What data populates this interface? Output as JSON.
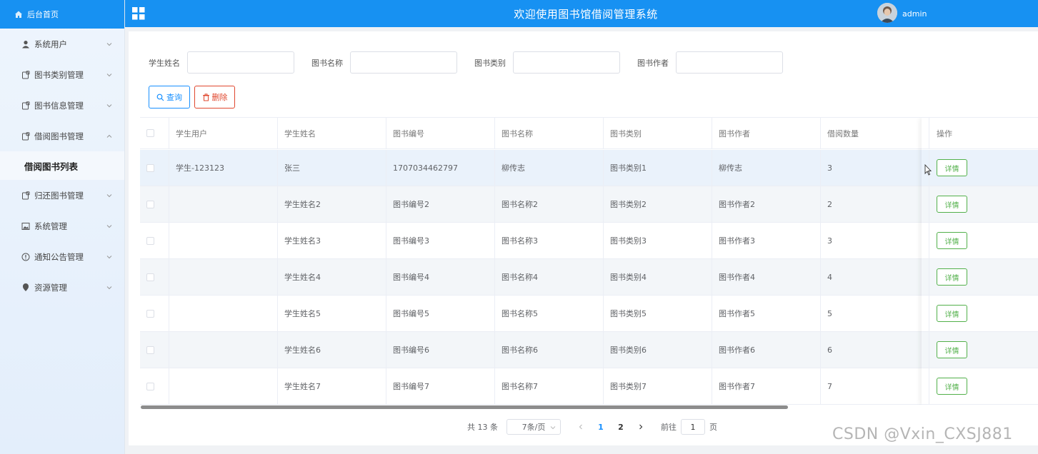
{
  "sidebar": {
    "home_label": "后台首页",
    "items": [
      {
        "label": "系统用户",
        "icon": "user-icon"
      },
      {
        "label": "图书类别管理",
        "icon": "doc-icon"
      },
      {
        "label": "图书信息管理",
        "icon": "doc-icon"
      },
      {
        "label": "借阅图书管理",
        "icon": "doc-icon",
        "expanded": true
      },
      {
        "label": "借阅图书列表",
        "sub": true
      },
      {
        "label": "归还图书管理",
        "icon": "doc-icon"
      },
      {
        "label": "系统管理",
        "icon": "image-icon"
      },
      {
        "label": "通知公告管理",
        "icon": "info-icon"
      },
      {
        "label": "资源管理",
        "icon": "pin-icon"
      }
    ]
  },
  "header": {
    "title": "欢迎使用图书馆借阅管理系统",
    "user": "admin"
  },
  "search": {
    "student_name_label": "学生姓名",
    "book_name_label": "图书名称",
    "book_category_label": "图书类别",
    "book_author_label": "图书作者",
    "student_name_value": "",
    "book_name_value": "",
    "book_category_value": "",
    "book_author_value": ""
  },
  "buttons": {
    "query": "查询",
    "delete": "删除"
  },
  "table": {
    "columns": [
      "学生用户",
      "学生姓名",
      "图书编号",
      "图书名称",
      "图书类别",
      "图书作者",
      "借阅数量",
      "操作"
    ],
    "detail_label": "详情",
    "rows": [
      [
        "学生-123123",
        "张三",
        "1707034462797",
        "柳传志",
        "图书类别1",
        "柳传志",
        "3"
      ],
      [
        "",
        "学生姓名2",
        "图书编号2",
        "图书名称2",
        "图书类别2",
        "图书作者2",
        "2"
      ],
      [
        "",
        "学生姓名3",
        "图书编号3",
        "图书名称3",
        "图书类别3",
        "图书作者3",
        "3"
      ],
      [
        "",
        "学生姓名4",
        "图书编号4",
        "图书名称4",
        "图书类别4",
        "图书作者4",
        "4"
      ],
      [
        "",
        "学生姓名5",
        "图书编号5",
        "图书名称5",
        "图书类别5",
        "图书作者5",
        "5"
      ],
      [
        "",
        "学生姓名6",
        "图书编号6",
        "图书名称6",
        "图书类别6",
        "图书作者6",
        "6"
      ],
      [
        "",
        "学生姓名7",
        "图书编号7",
        "图书名称7",
        "图书类别7",
        "图书作者7",
        "7"
      ]
    ]
  },
  "pagination": {
    "total": "共 13 条",
    "page_size": "7条/页",
    "pages": [
      "1",
      "2"
    ],
    "current_page": "1",
    "goto_label": "前往",
    "goto_value": "1",
    "page_suffix": "页"
  },
  "watermark": "CSDN @Vxin_CXSJ881",
  "colors": {
    "primary": "#1791f2",
    "danger": "#e0472e",
    "success": "#52b04a"
  }
}
